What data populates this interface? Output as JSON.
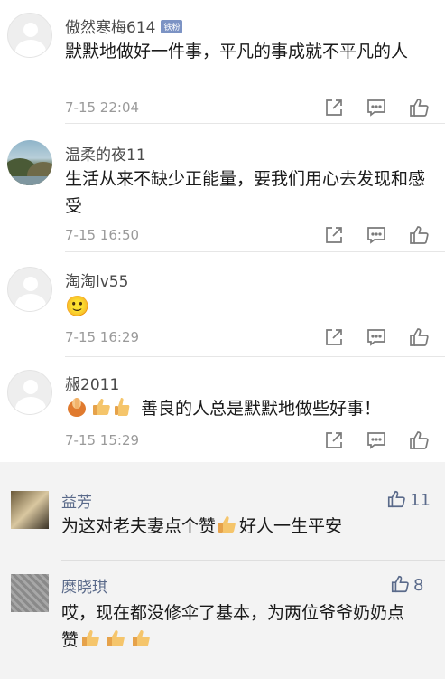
{
  "comments": [
    {
      "name": "傲然寒梅614",
      "badge": "铁粉",
      "text": "默默地做好一件事，平凡的事成就不平凡的人",
      "time": "7-15 22:04"
    },
    {
      "name": "温柔的夜11",
      "text": "生活从来不缺少正能量，要我们用心去发现和感受",
      "time": "7-15 16:50"
    },
    {
      "name": "淘淘lv55",
      "text": "🙂",
      "time": "7-15 16:29"
    },
    {
      "name": "赧2011",
      "text": "善良的人总是默默地做些好事！",
      "time": "7-15 15:29"
    }
  ],
  "hot": [
    {
      "name": "益芳",
      "text_a": "为这对老夫妻点个赞",
      "text_b": "好人一生平安",
      "likes": "11"
    },
    {
      "name": "糜晓琪",
      "text": "哎，现在都没修伞了基本，为两位爷爷奶奶点赞",
      "likes": "8"
    }
  ],
  "icons": {
    "share": "share-icon",
    "reply": "comment-icon",
    "like": "thumbs-up-icon"
  },
  "colors": {
    "name": "#4a4a4a",
    "time": "#9a9a9a",
    "hot_name": "#5a6a8a",
    "hot_bg": "#f3f3f3"
  }
}
